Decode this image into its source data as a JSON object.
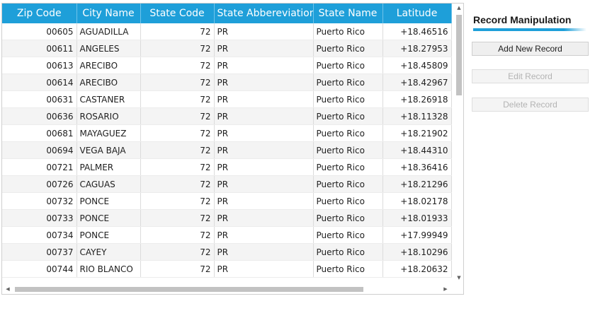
{
  "grid": {
    "columns": [
      "Zip Code",
      "City Name",
      "State Code",
      "State Abbereviation",
      "State Name",
      "Latitude"
    ],
    "rows": [
      [
        "00605",
        "AGUADILLA",
        "72",
        "PR",
        "Puerto Rico",
        "+18.46516"
      ],
      [
        "00611",
        "ANGELES",
        "72",
        "PR",
        "Puerto Rico",
        "+18.27953"
      ],
      [
        "00613",
        "ARECIBO",
        "72",
        "PR",
        "Puerto Rico",
        "+18.45809"
      ],
      [
        "00614",
        "ARECIBO",
        "72",
        "PR",
        "Puerto Rico",
        "+18.42967"
      ],
      [
        "00631",
        "CASTANER",
        "72",
        "PR",
        "Puerto Rico",
        "+18.26918"
      ],
      [
        "00636",
        "ROSARIO",
        "72",
        "PR",
        "Puerto Rico",
        "+18.11328"
      ],
      [
        "00681",
        "MAYAGUEZ",
        "72",
        "PR",
        "Puerto Rico",
        "+18.21902"
      ],
      [
        "00694",
        "VEGA BAJA",
        "72",
        "PR",
        "Puerto Rico",
        "+18.44310"
      ],
      [
        "00721",
        "PALMER",
        "72",
        "PR",
        "Puerto Rico",
        "+18.36416"
      ],
      [
        "00726",
        "CAGUAS",
        "72",
        "PR",
        "Puerto Rico",
        "+18.21296"
      ],
      [
        "00732",
        "PONCE",
        "72",
        "PR",
        "Puerto Rico",
        "+18.02178"
      ],
      [
        "00733",
        "PONCE",
        "72",
        "PR",
        "Puerto Rico",
        "+18.01933"
      ],
      [
        "00734",
        "PONCE",
        "72",
        "PR",
        "Puerto Rico",
        "+17.99949"
      ],
      [
        "00737",
        "CAYEY",
        "72",
        "PR",
        "Puerto Rico",
        "+18.10296"
      ],
      [
        "00744",
        "RIO BLANCO",
        "72",
        "PR",
        "Puerto Rico",
        "+18.20632"
      ]
    ]
  },
  "scrollbars": {
    "up_arrow": "▲",
    "down_arrow": "▼",
    "left_arrow": "◀",
    "right_arrow": "▶"
  },
  "side_panel": {
    "title": "Record Manipulation",
    "accent_color": "#1e9fd9",
    "buttons": {
      "add": "Add New Record",
      "edit": "Edit Record",
      "delete": "Delete Record"
    }
  }
}
